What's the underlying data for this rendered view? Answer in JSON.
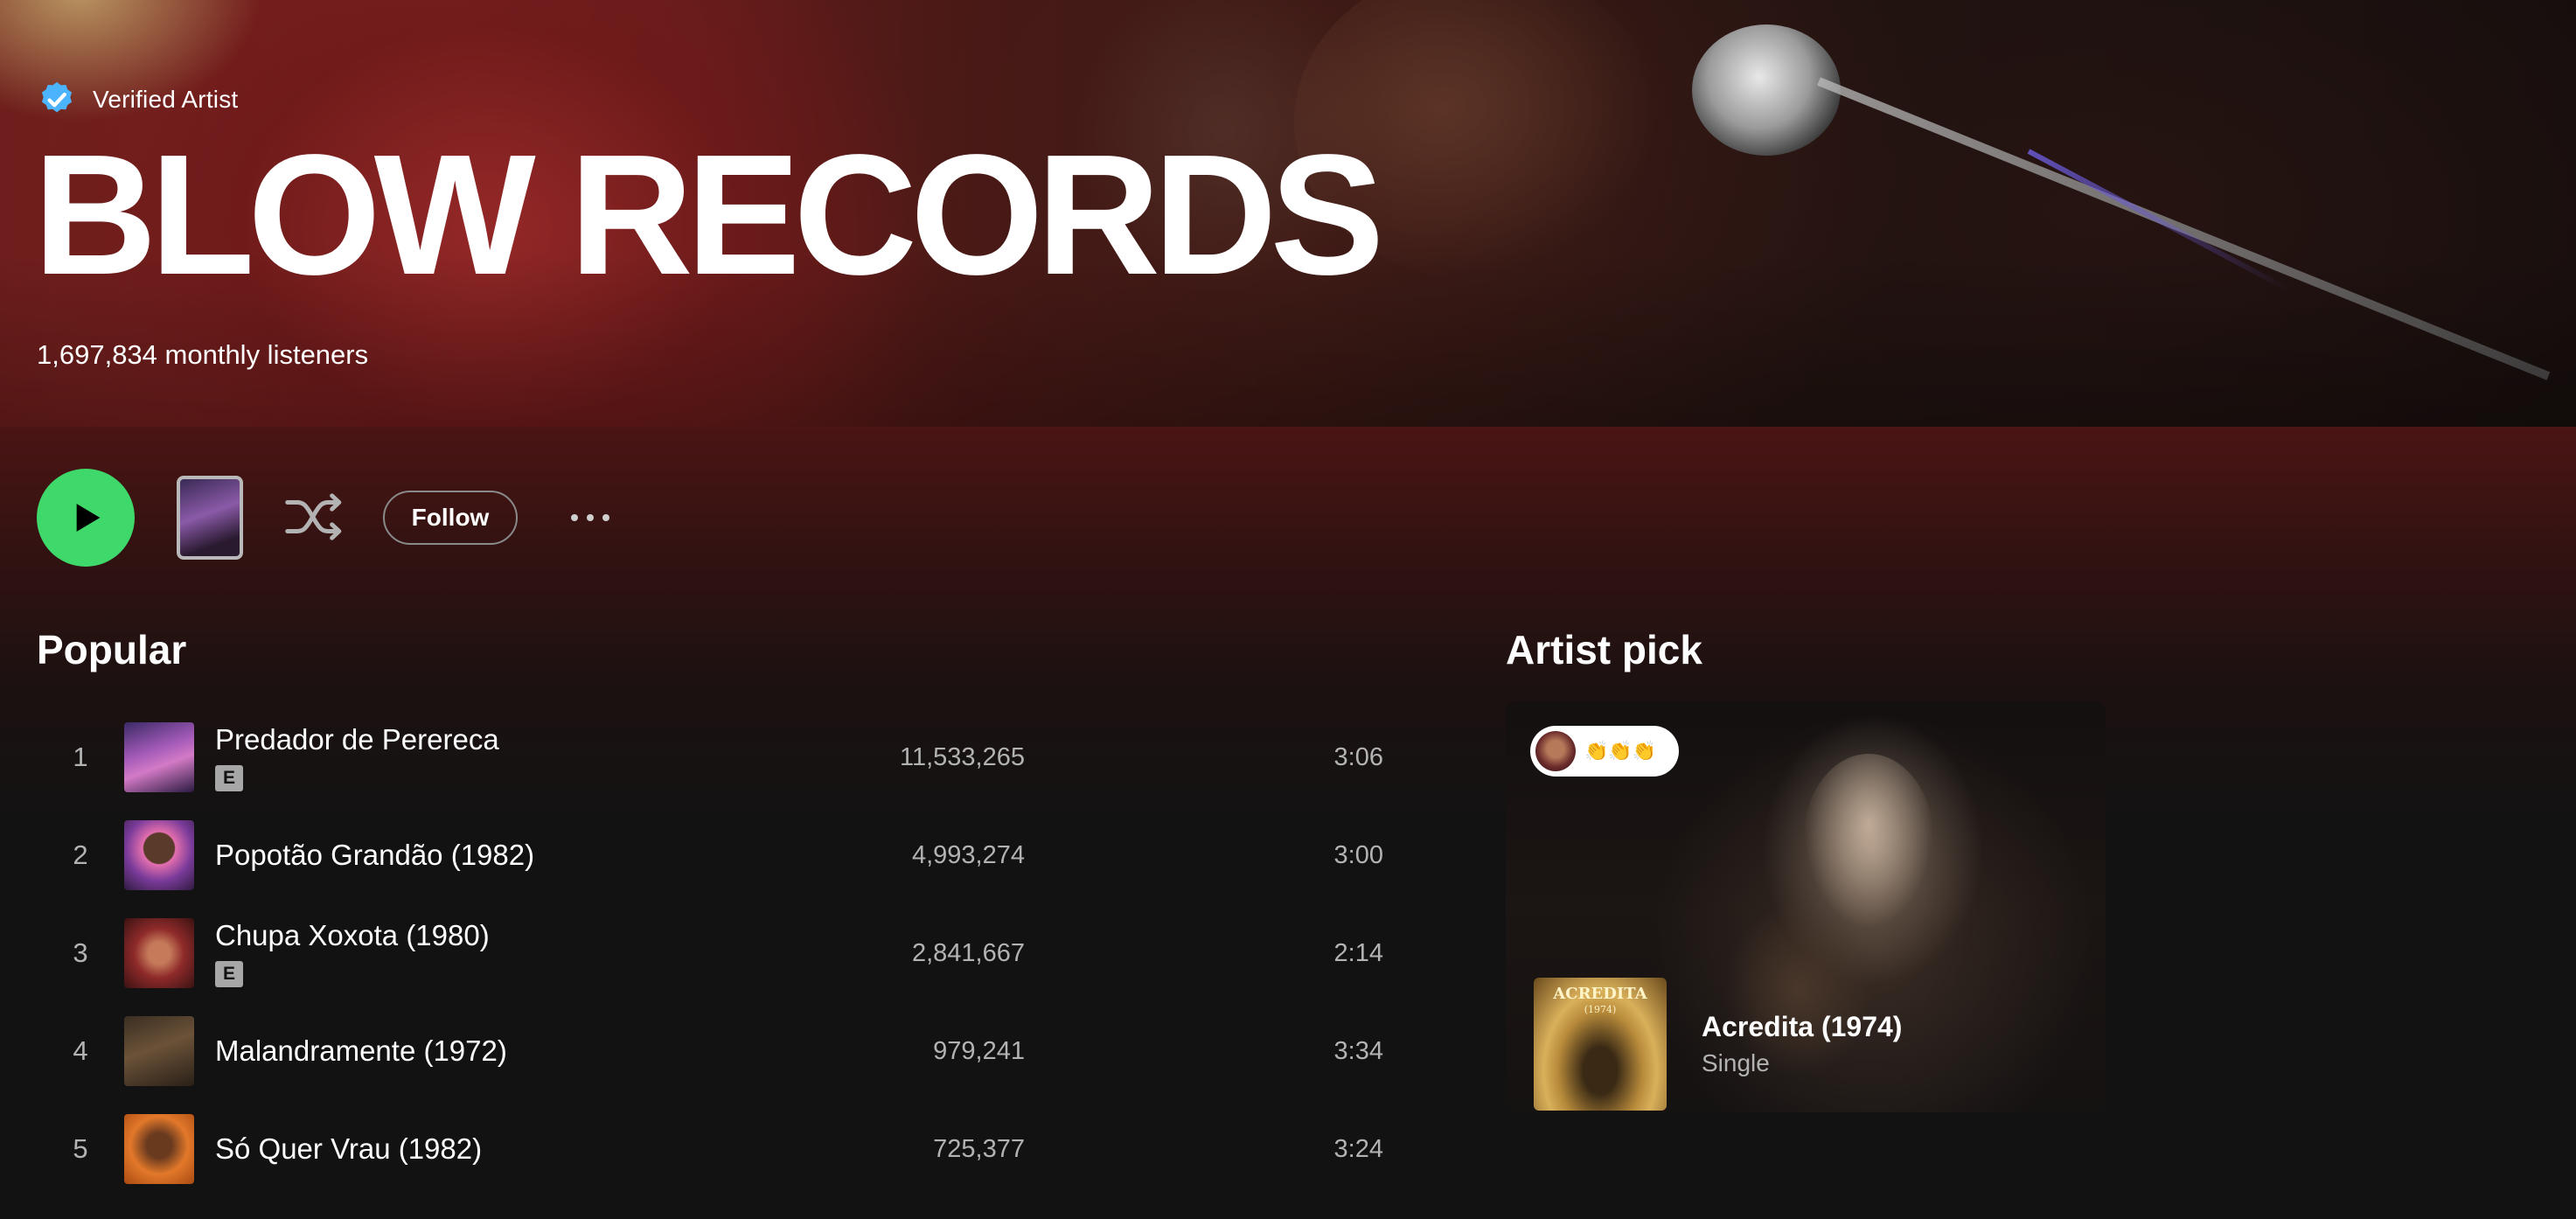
{
  "header": {
    "verified_label": "Verified Artist",
    "artist_name": "BLOW RECORDS",
    "monthly_listeners": "1,697,834 monthly listeners"
  },
  "actions": {
    "follow_label": "Follow",
    "play_icon": "play-icon",
    "shuffle_icon": "shuffle-icon",
    "more_icon": "more-options-icon"
  },
  "popular": {
    "title": "Popular",
    "tracks": [
      {
        "number": "1",
        "title": "Predador de Perereca",
        "explicit": true,
        "explicit_label": "E",
        "plays": "11,533,265",
        "duration": "3:06"
      },
      {
        "number": "2",
        "title": "Popotão Grandão (1982)",
        "explicit": false,
        "explicit_label": "",
        "plays": "4,993,274",
        "duration": "3:00"
      },
      {
        "number": "3",
        "title": "Chupa Xoxota (1980)",
        "explicit": true,
        "explicit_label": "E",
        "plays": "2,841,667",
        "duration": "2:14"
      },
      {
        "number": "4",
        "title": "Malandramente (1972)",
        "explicit": false,
        "explicit_label": "",
        "plays": "979,241",
        "duration": "3:34"
      },
      {
        "number": "5",
        "title": "Só Quer Vrau (1982)",
        "explicit": false,
        "explicit_label": "",
        "plays": "725,377",
        "duration": "3:24"
      }
    ]
  },
  "artist_pick": {
    "title": "Artist pick",
    "badge_emoji": "👏👏👏",
    "cover_title": "ACREDITA",
    "cover_year": "(1974)",
    "release_title": "Acredita (1974)",
    "release_type": "Single"
  },
  "colors": {
    "accent_green": "#3fd86b",
    "background": "#121212",
    "secondary_text": "#b3b3b3",
    "verified_blue": "#4cb3ff"
  }
}
